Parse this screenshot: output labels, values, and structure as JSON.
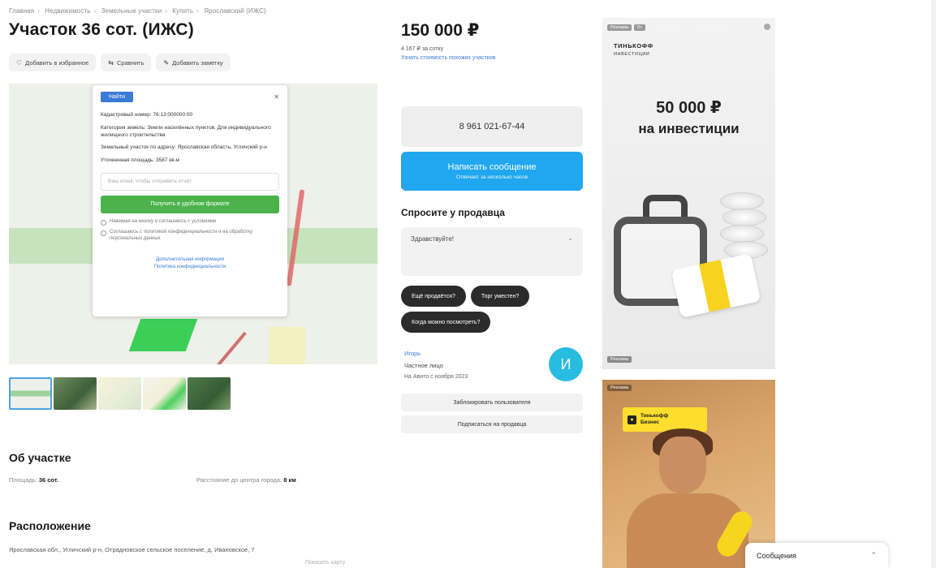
{
  "breadcrumb": {
    "items": [
      "Главная",
      "Недвижимость",
      "Земельные участки",
      "Купить",
      "Ярославский (ИЖС)"
    ]
  },
  "listing": {
    "title": "Участок 36 сот. (ИЖС)",
    "actions": [
      {
        "icon": "heart-icon",
        "label": "Добавить в избранное"
      },
      {
        "icon": "compare-icon",
        "label": "Сравнить"
      },
      {
        "icon": "note-icon",
        "label": "Добавить заметку"
      }
    ]
  },
  "gallery": {
    "popup": {
      "button_label": "Найти",
      "cadastral": "Кадастровый номер: 76:13:000000:00",
      "category": "Категория земель: Земли населённых пунктов. Для индивидуального жилищного строительства",
      "address": "Земельный участок по адресу: Ярославская область, Угличский р-н",
      "area": "Уточненная площадь: 3587 кв.м",
      "input_placeholder": "Ваш email, чтобы отправить отчёт",
      "green_button": "Получить в удобном формате",
      "check1": "Нажимая на кнопку я соглашаюсь с условиями",
      "check2": "Соглашаюсь с политикой конфиденциальности и на обработку персональных данных",
      "links": [
        "Дополнительная информация",
        "Политика конфиденциальности"
      ]
    },
    "thumb_count": 5
  },
  "about": {
    "heading": "Об участке",
    "area_label": "Площадь:",
    "area_value": "36 сот.",
    "distance_label": "Расстояние до центра города:",
    "distance_value": "8 км"
  },
  "location": {
    "heading": "Расположение",
    "address": "Ярославская обл., Угличский р-н, Отрадновское сельское поселение, д. Ивановское, 7",
    "map_link": "Показать карту"
  },
  "price": {
    "value": "150 000 ₽",
    "per_unit": "4 167 ₽ за сотку",
    "link": "Узнать стоимость похожих участков"
  },
  "contact": {
    "phone": "8 961 021-67-44",
    "message_title": "Написать сообщение",
    "message_sub": "Отвечает за несколько часов"
  },
  "ask": {
    "heading": "Спросите у продавца",
    "placeholder": "Здравствуйте!",
    "questions": [
      "Ещё продаётся?",
      "Торг уместен?",
      "Когда можно посмотреть?"
    ]
  },
  "seller": {
    "name": "Игорь",
    "type": "Частное лицо",
    "since": "На Авито с ноября 2023",
    "avatar_letter": "И",
    "btn_subscribe": "Подписаться на продавца",
    "btn_notice": "Заблокировать пользователя"
  },
  "ads": {
    "ad1": {
      "badge1": "Реклама",
      "badge2": "0+",
      "brand": "ТИНЬКОФФ",
      "brand_sub": "ИНВЕСТИЦИИ",
      "amount": "50 000 ₽",
      "line": "на инвестиции",
      "footer": "Реклама"
    },
    "ad2": {
      "badge": "Реклама",
      "logo": "Тинькофф",
      "logo_sub": "Бизнес"
    }
  },
  "messages_bar": {
    "label": "Сообщения"
  },
  "colors": {
    "accent_blue": "#20a7ef",
    "dark_chip": "#2b2b2b",
    "avatar": "#27bde0",
    "map_green": "#4cb34c",
    "ad_yellow": "#ffdd2d"
  }
}
